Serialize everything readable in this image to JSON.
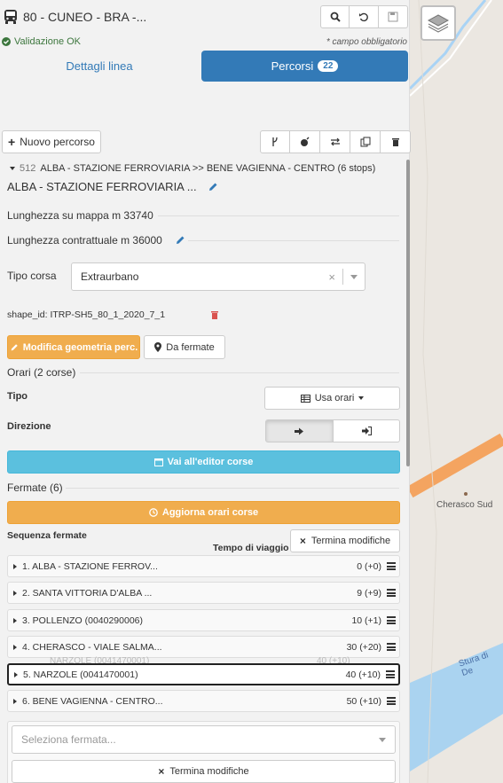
{
  "header": {
    "title": "80 - CUNEO - BRA -...",
    "validation": "Validazione OK",
    "required_note": "* campo obbligatorio"
  },
  "tabs": {
    "details": "Dettagli linea",
    "routes": "Percorsi",
    "routes_count": "22"
  },
  "toolbar": {
    "new_route": "Nuovo percorso"
  },
  "route": {
    "header_id": "512",
    "header_text": "ALBA - STAZIONE FERROVIARIA >> BENE VAGIENNA - CENTRO (6 stops)",
    "name": "ALBA - STAZIONE FERROVIARIA ...",
    "map_length": "Lunghezza su mappa m 33740",
    "contract_length": "Lunghezza contrattuale m 36000",
    "trip_type_label": "Tipo corsa",
    "trip_type_value": "Extraurbano",
    "shape_id": "shape_id: ITRP-SH5_80_1_2020_7_1",
    "edit_geometry": "Modifica geometria perc.",
    "from_stops": "Da fermate"
  },
  "timetable": {
    "section": "Orari (2 corse)",
    "type_label": "Tipo",
    "type_value": "Usa orari",
    "direction_label": "Direzione",
    "editor_button": "Vai all'editor corse"
  },
  "stops": {
    "section": "Fermate (6)",
    "update_button": "Aggiorna orari corse",
    "sequence_label": "Sequenza fermate",
    "travel_time_label": "Tempo di viaggio",
    "end_edit": "Termina modifiche",
    "ghost_text": "NARZOLE (0041470001)",
    "ghost_value": "40 (+10)",
    "items": [
      {
        "label": "1. ALBA - STAZIONE FERROV...",
        "value": "0 (+0)"
      },
      {
        "label": "2. SANTA VITTORIA D'ALBA ...",
        "value": "9 (+9)"
      },
      {
        "label": "3. POLLENZO (0040290006)",
        "value": "10 (+1)"
      },
      {
        "label": "4. CHERASCO - VIALE SALMA...",
        "value": "30 (+20)"
      },
      {
        "label": "5. NARZOLE (0041470001)",
        "value": "40 (+10)"
      },
      {
        "label": "6. BENE VAGIENNA - CENTRO...",
        "value": "50 (+10)"
      }
    ],
    "select_placeholder": "Seleziona fermata...",
    "end_edit_bottom": "Termina modifiche"
  },
  "map": {
    "label_cherasco": "Cherasco Sud",
    "label_river": "Stura di De"
  }
}
